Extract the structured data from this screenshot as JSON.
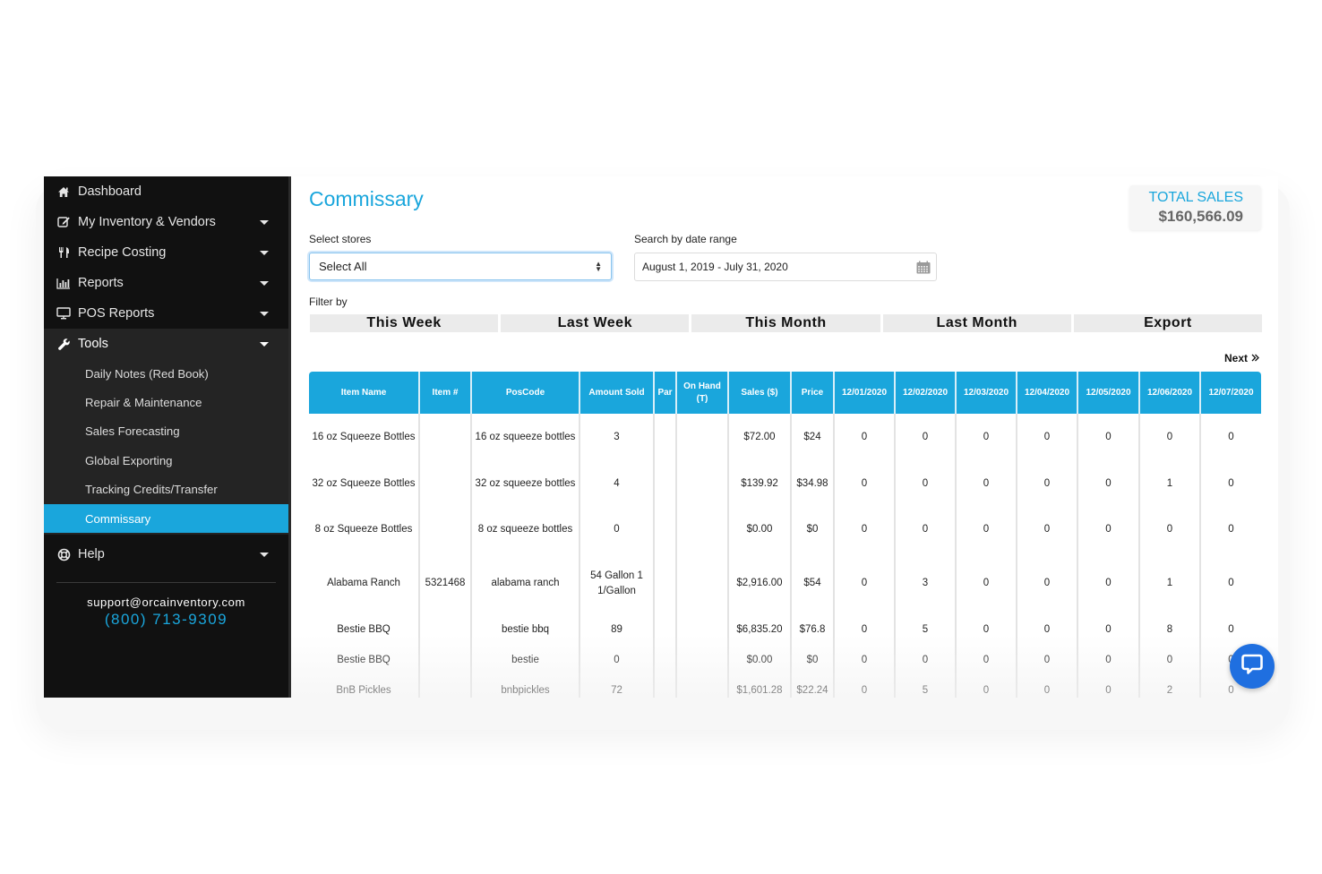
{
  "sidebar": {
    "items": [
      {
        "label": "Dashboard",
        "icon": "home-icon",
        "has_caret": false
      },
      {
        "label": "My Inventory & Vendors",
        "icon": "edit-icon",
        "has_caret": true
      },
      {
        "label": "Recipe Costing",
        "icon": "utensils-icon",
        "has_caret": true
      },
      {
        "label": "Reports",
        "icon": "bar-chart-icon",
        "has_caret": true
      },
      {
        "label": "POS Reports",
        "icon": "monitor-icon",
        "has_caret": true
      },
      {
        "label": "Tools",
        "icon": "wrench-icon",
        "has_caret": true,
        "open": true
      }
    ],
    "tools_submenu": [
      {
        "label": "Daily Notes (Red Book)"
      },
      {
        "label": "Repair & Maintenance"
      },
      {
        "label": "Sales Forecasting"
      },
      {
        "label": "Global Exporting"
      },
      {
        "label": "Tracking Credits/Transfer"
      },
      {
        "label": "Commissary",
        "active": true
      }
    ],
    "help": {
      "label": "Help",
      "icon": "lifebuoy-icon"
    },
    "support_email": "support@orcainventory.com",
    "support_phone": "(800) 713-9309"
  },
  "main": {
    "title": "Commissary",
    "total_sales": {
      "label": "TOTAL SALES",
      "value": "$160,566.09"
    },
    "select_stores": {
      "label": "Select stores",
      "value": "Select All"
    },
    "date_range": {
      "label": "Search by date range",
      "value": "August 1, 2019 - July 31, 2020"
    },
    "filter": {
      "label": "Filter by",
      "buttons": [
        "This Week",
        "Last Week",
        "This Month",
        "Last Month",
        "Export"
      ]
    },
    "next_label": "Next"
  },
  "table": {
    "headers": [
      "Item Name",
      "Item #",
      "PosCode",
      "Amount Sold",
      "Par",
      "On Hand (T)",
      "Sales ($)",
      "Price",
      "12/01/2020",
      "12/02/2020",
      "12/03/2020",
      "12/04/2020",
      "12/05/2020",
      "12/06/2020",
      "12/07/2020"
    ],
    "rows": [
      [
        "16 oz Squeeze Bottles",
        "",
        "16 oz squeeze bottles",
        "3",
        "",
        "",
        "$72.00",
        "$24",
        "0",
        "0",
        "0",
        "0",
        "0",
        "0",
        "0"
      ],
      [
        "32 oz Squeeze Bottles",
        "",
        "32 oz squeeze bottles",
        "4",
        "",
        "",
        "$139.92",
        "$34.98",
        "0",
        "0",
        "0",
        "0",
        "0",
        "1",
        "0"
      ],
      [
        "8 oz Squeeze Bottles",
        "",
        "8 oz squeeze bottles",
        "0",
        "",
        "",
        "$0.00",
        "$0",
        "0",
        "0",
        "0",
        "0",
        "0",
        "0",
        "0"
      ],
      [
        "Alabama Ranch",
        "5321468",
        "alabama ranch",
        "54 Gallon 1 1/Gallon",
        "",
        "",
        "$2,916.00",
        "$54",
        "0",
        "3",
        "0",
        "0",
        "0",
        "1",
        "0"
      ],
      [
        "Bestie BBQ",
        "",
        "bestie bbq",
        "89",
        "",
        "",
        "$6,835.20",
        "$76.8",
        "0",
        "5",
        "0",
        "0",
        "0",
        "8",
        "0"
      ],
      [
        "Bestie BBQ",
        "",
        "bestie",
        "0",
        "",
        "",
        "$0.00",
        "$0",
        "0",
        "0",
        "0",
        "0",
        "0",
        "0",
        "0"
      ],
      [
        "BnB Pickles",
        "",
        "bnbpickles",
        "72",
        "",
        "",
        "$1,601.28",
        "$22.24",
        "0",
        "5",
        "0",
        "0",
        "0",
        "2",
        "0"
      ]
    ]
  },
  "colors": {
    "accent": "#1aa6dc",
    "sidebar_bg": "#111111",
    "chat_button": "#1f6fe0"
  }
}
